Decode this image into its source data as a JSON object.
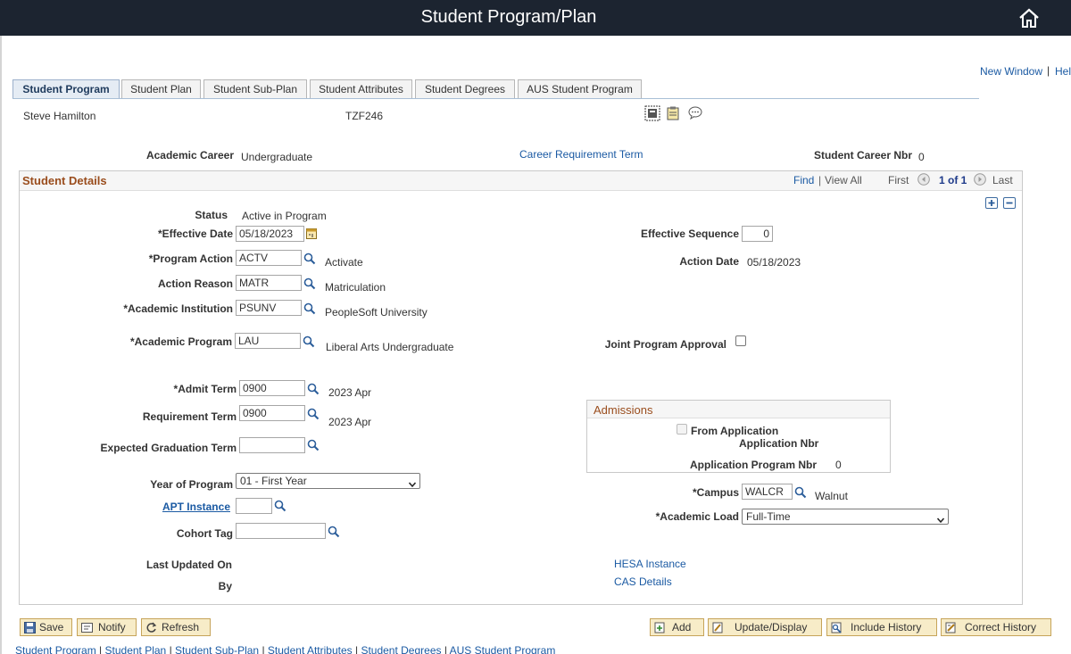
{
  "header": {
    "title": "Student Program/Plan"
  },
  "top_links": {
    "new_window": "New Window",
    "separator": "|",
    "help": "Hel"
  },
  "tabs": [
    {
      "label": "Student Program",
      "active": true
    },
    {
      "label": "Student Plan"
    },
    {
      "label": "Student Sub-Plan"
    },
    {
      "label": "Student Attributes"
    },
    {
      "label": "Student Degrees"
    },
    {
      "label": "AUS Student Program"
    }
  ],
  "student": {
    "name": "Steve Hamilton",
    "id": "TZF246"
  },
  "career_row": {
    "academic_career_label": "Academic Career",
    "academic_career_value": "Undergraduate",
    "career_requirement_term": "Career Requirement Term",
    "student_career_nbr_label": "Student Career Nbr",
    "student_career_nbr_value": "0"
  },
  "panel": {
    "title": "Student Details",
    "nav": {
      "find": "Find",
      "sep": "|",
      "view_all": "View All",
      "first": "First",
      "count": "1 of 1",
      "last": "Last"
    }
  },
  "fields": {
    "status_label": "Status",
    "status_value": "Active in Program",
    "effective_date_label": "*Effective Date",
    "effective_date_value": "05/18/2023",
    "effective_sequence_label": "Effective Sequence",
    "effective_sequence_value": "0",
    "program_action_label": "*Program Action",
    "program_action_value": "ACTV",
    "program_action_desc": "Activate",
    "action_date_label": "Action Date",
    "action_date_value": "05/18/2023",
    "action_reason_label": "Action Reason",
    "action_reason_value": "MATR",
    "action_reason_desc": "Matriculation",
    "academic_institution_label": "*Academic Institution",
    "academic_institution_value": "PSUNV",
    "academic_institution_desc": "PeopleSoft University",
    "academic_program_label": "*Academic Program",
    "academic_program_value": "LAU",
    "academic_program_desc": "Liberal Arts Undergraduate",
    "joint_program_label": "Joint Program Approval",
    "admit_term_label": "*Admit Term",
    "admit_term_value": "0900",
    "admit_term_desc": "2023 Apr",
    "requirement_term_label": "Requirement Term",
    "requirement_term_value": "0900",
    "requirement_term_desc": "2023 Apr",
    "expected_grad_label": "Expected Graduation Term",
    "expected_grad_value": "",
    "year_of_program_label": "Year of Program",
    "year_of_program_value": "01 - First Year",
    "apt_instance_label": "APT Instance",
    "apt_instance_value": "",
    "cohort_tag_label": "Cohort Tag",
    "cohort_tag_value": "",
    "campus_label": "*Campus",
    "campus_value": "WALCR",
    "campus_desc": "Walnut",
    "academic_load_label": "*Academic Load",
    "academic_load_value": "Full-Time",
    "last_updated_label": "Last Updated On",
    "by_label": "By",
    "hesa_instance": "HESA Instance",
    "cas_details": "CAS Details"
  },
  "admissions": {
    "title": "Admissions",
    "from_application_label": "From Application",
    "application_nbr_label": "Application Nbr",
    "application_program_nbr_label": "Application Program Nbr",
    "application_program_nbr_value": "0"
  },
  "buttons": {
    "save": "Save",
    "notify": "Notify",
    "refresh": "Refresh",
    "add": "Add",
    "update_display": "Update/Display",
    "include_history": "Include History",
    "correct_history": "Correct History"
  },
  "footer_links": [
    "Student Program",
    "Student Plan",
    "Student Sub-Plan",
    "Student Attributes",
    "Student Degrees",
    "AUS Student Program"
  ],
  "colors": {
    "header_bg": "#1c2430",
    "link": "#1b5aa3",
    "section_title": "#9a4d1d",
    "button_bg": "#f7ecc8"
  }
}
